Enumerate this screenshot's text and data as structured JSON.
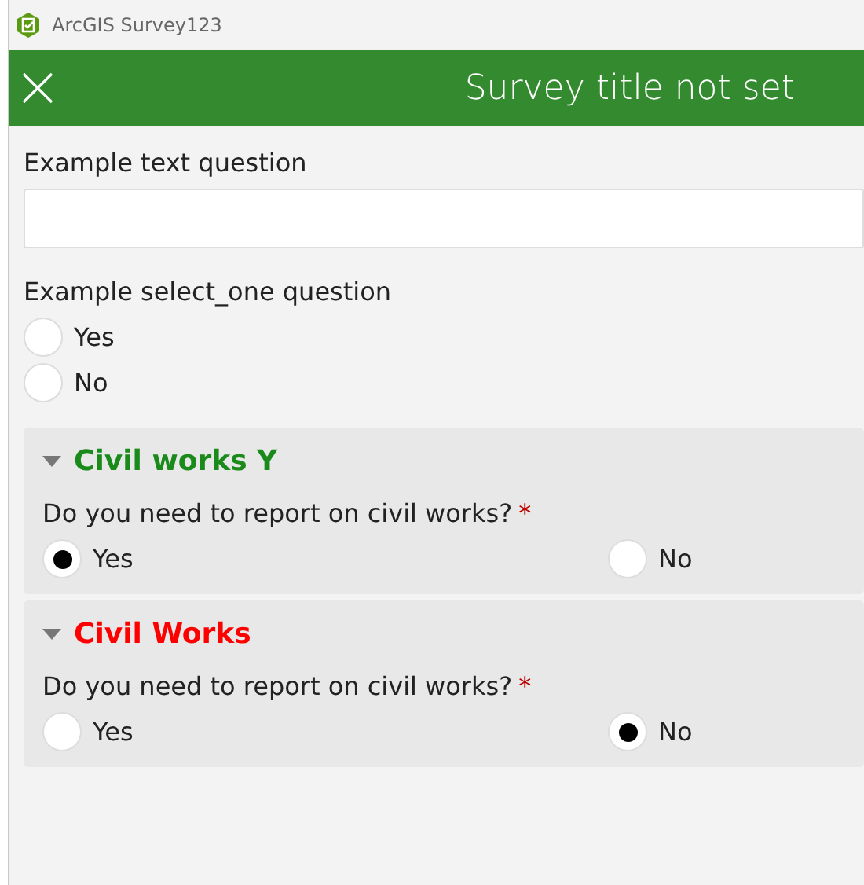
{
  "window": {
    "title": "ArcGIS Survey123"
  },
  "header": {
    "title": "Survey title not set"
  },
  "questions": [
    {
      "kind": "text",
      "label": "Example text question"
    },
    {
      "kind": "select_one",
      "label": "Example select_one question",
      "options": [
        {
          "label": "Yes",
          "selected": false
        },
        {
          "label": "No",
          "selected": false
        }
      ]
    }
  ],
  "groups": [
    {
      "title": "Civil works Y",
      "color": "#1a8a1a",
      "expanded": true,
      "question": {
        "label": "Do you need to report on civil works?",
        "required_mark": "*",
        "options": [
          {
            "label": "Yes",
            "selected": true
          },
          {
            "label": "No",
            "selected": false
          }
        ]
      }
    },
    {
      "title": "Civil Works",
      "color": "#ff0000",
      "expanded": true,
      "question": {
        "label": "Do you need to report on civil works?",
        "required_mark": "*",
        "options": [
          {
            "label": "Yes",
            "selected": false
          },
          {
            "label": "No",
            "selected": true
          }
        ]
      }
    }
  ]
}
